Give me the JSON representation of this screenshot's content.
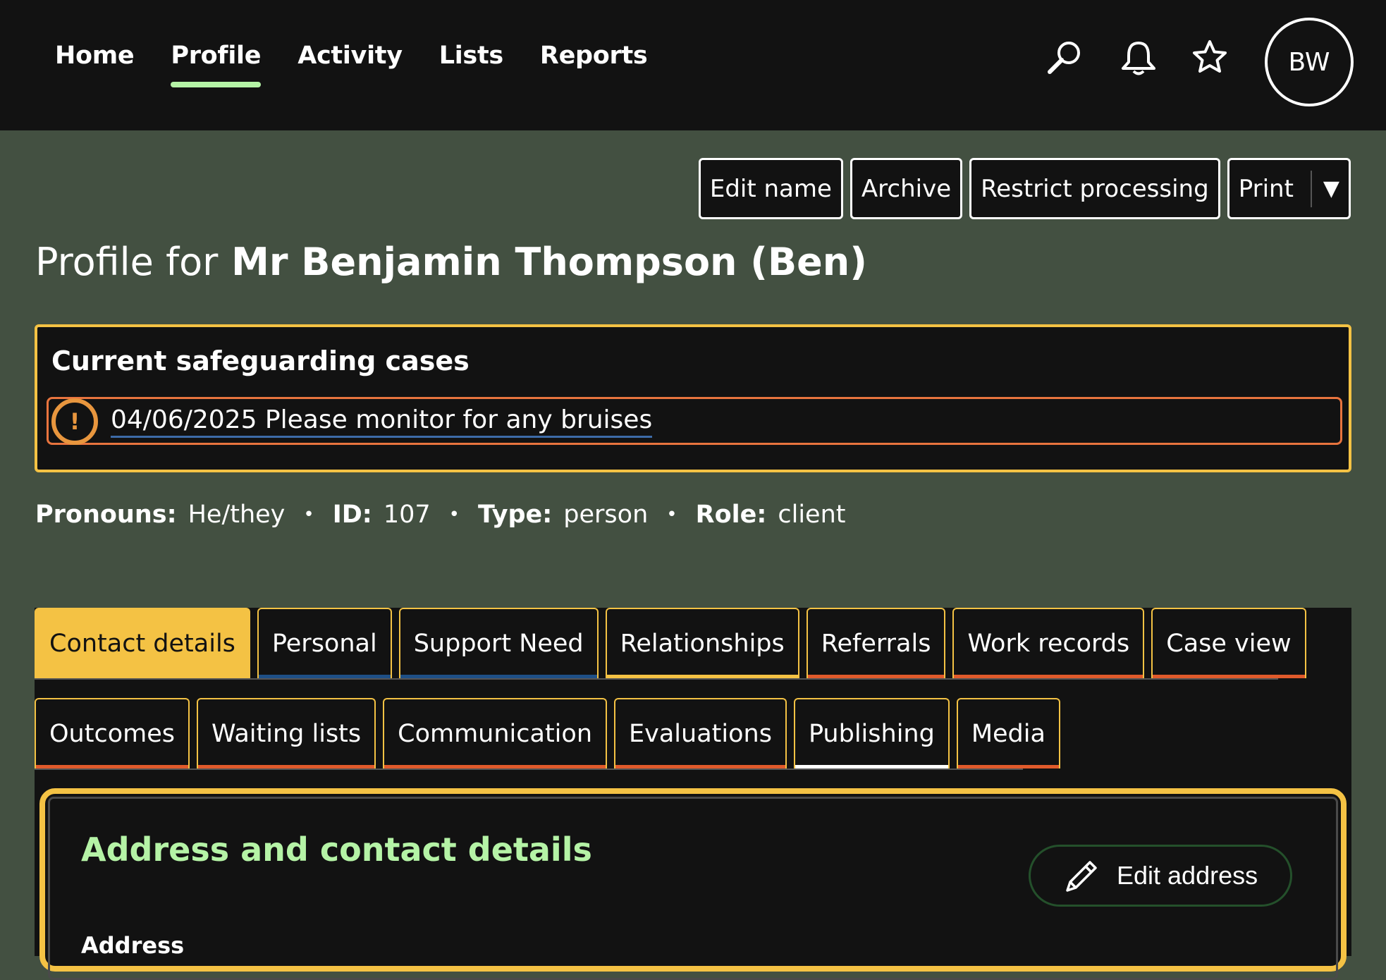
{
  "nav": {
    "items": [
      {
        "label": "Home"
      },
      {
        "label": "Profile",
        "active": true
      },
      {
        "label": "Activity"
      },
      {
        "label": "Lists"
      },
      {
        "label": "Reports"
      }
    ],
    "icons": [
      "search-icon",
      "bell-icon",
      "star-icon"
    ],
    "avatar_initials": "BW"
  },
  "actions": {
    "edit_name": "Edit name",
    "archive": "Archive",
    "restrict": "Restrict processing",
    "print": "Print",
    "print_caret": "▼"
  },
  "title": {
    "prefix": "Profile for",
    "name": "Mr Benjamin Thompson (Ben)"
  },
  "safeguarding": {
    "title": "Current safeguarding cases",
    "alert_symbol": "!",
    "cases": [
      {
        "text": "04/06/2025 Please monitor for any bruises"
      }
    ]
  },
  "meta": {
    "pronouns_label": "Pronouns:",
    "pronouns": "He/they",
    "id_label": "ID:",
    "id": "107",
    "type_label": "Type:",
    "type": "person",
    "role_label": "Role:",
    "role": "client",
    "separator": "•"
  },
  "tabs": {
    "row1": [
      {
        "label": "Contact details",
        "active": true
      },
      {
        "label": "Personal",
        "bar": "#1e4f86"
      },
      {
        "label": "Support Need",
        "bar": "#1e4f86"
      },
      {
        "label": "Relationships",
        "bar": "#f4c244"
      },
      {
        "label": "Referrals",
        "bar": "#e05a2b"
      },
      {
        "label": "Work records",
        "bar": "#e05a2b"
      },
      {
        "label": "Case view",
        "bar": "#e05a2b"
      }
    ],
    "row2": [
      {
        "label": "Outcomes",
        "bar": "#e05a2b"
      },
      {
        "label": "Waiting lists",
        "bar": "#e05a2b"
      },
      {
        "label": "Communication",
        "bar": "#e05a2b"
      },
      {
        "label": "Evaluations",
        "bar": "#e05a2b"
      },
      {
        "label": "Publishing",
        "bar": "#ffffff"
      },
      {
        "label": "Media",
        "bar": "#e05a2b"
      }
    ]
  },
  "panel": {
    "title": "Address and contact details",
    "edit_button": "Edit address",
    "edit_icon": "pencil-icon",
    "subheading": "Address"
  },
  "colors": {
    "page_bg": "#435041",
    "topbar_bg": "#121212",
    "accent_green": "#b5f3a6",
    "accent_yellow": "#f4c244",
    "alert_orange": "#e8743e"
  }
}
